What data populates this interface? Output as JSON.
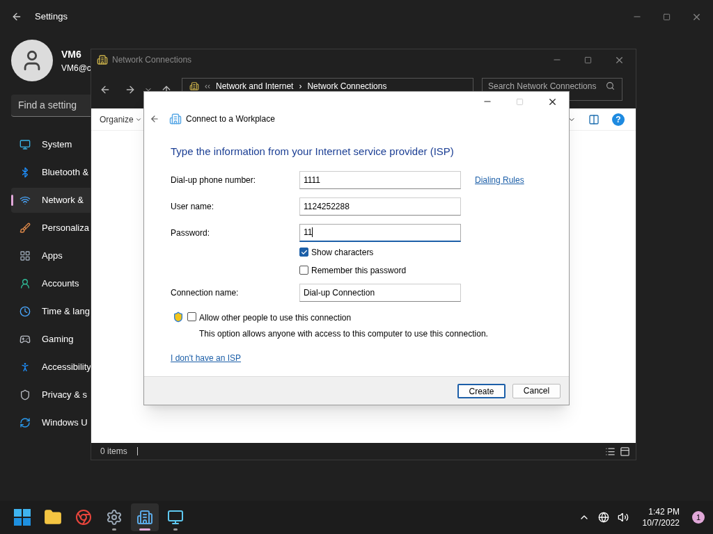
{
  "settings": {
    "title": "Settings",
    "user": {
      "name": "VM6",
      "email": "VM6@c"
    },
    "search": {
      "placeholder": "Find a setting"
    },
    "nav": [
      {
        "label": "System",
        "kind": "system",
        "selected": false
      },
      {
        "label": "Bluetooth &",
        "kind": "bluetooth",
        "selected": false
      },
      {
        "label": "Network &",
        "kind": "network",
        "selected": true
      },
      {
        "label": "Personaliza",
        "kind": "brush",
        "selected": false
      },
      {
        "label": "Apps",
        "kind": "apps",
        "selected": false
      },
      {
        "label": "Accounts",
        "kind": "accounts",
        "selected": false
      },
      {
        "label": "Time & lang",
        "kind": "time",
        "selected": false
      },
      {
        "label": "Gaming",
        "kind": "gaming",
        "selected": false
      },
      {
        "label": "Accessibility",
        "kind": "accessibility",
        "selected": false
      },
      {
        "label": "Privacy & s",
        "kind": "privacy",
        "selected": false
      },
      {
        "label": "Windows U",
        "kind": "update",
        "selected": false
      }
    ]
  },
  "explorer": {
    "title": "Network Connections",
    "overflow": "‹‹",
    "separator": "›",
    "help": "?",
    "breadcrumb": [
      "Network and Internet",
      "Network Connections"
    ],
    "search": {
      "placeholder": "Search Network Connections"
    },
    "organize": "Organize",
    "status": "0 items"
  },
  "dialog": {
    "title": "Connect to a Workplace",
    "heading": "Type the information from your Internet service provider (ISP)",
    "fields": [
      {
        "label": "Dial-up phone number:",
        "value": "1111",
        "focused": false
      },
      {
        "label": "User name:",
        "value": "1124252288",
        "focused": false
      },
      {
        "label": "Password:",
        "value": "11",
        "focused": true
      }
    ],
    "dialing_rules": "Dialing Rules",
    "checks": [
      {
        "label": "Show characters",
        "checked": true
      },
      {
        "label": "Remember this password",
        "checked": false
      }
    ],
    "connection": {
      "label": "Connection name:",
      "value": "Dial-up Connection"
    },
    "allow": {
      "label": "Allow other people to use this connection",
      "checked": false,
      "note": "This option allows anyone with access to this computer to use this connection."
    },
    "isp_link": "I don't have an ISP",
    "buttons": [
      {
        "label": "Create",
        "default": true
      },
      {
        "label": "Cancel",
        "default": false
      }
    ]
  },
  "taskbar": {
    "apps": [
      {
        "kind": "start",
        "running": false,
        "selected": false
      },
      {
        "kind": "folder",
        "running": false,
        "selected": false
      },
      {
        "kind": "browser",
        "running": false,
        "selected": false
      },
      {
        "kind": "settings",
        "running": true,
        "selected": false
      },
      {
        "kind": "network",
        "running": true,
        "selected": true
      },
      {
        "kind": "control",
        "running": true,
        "selected": false
      }
    ],
    "time": "1:42 PM",
    "date": "10/7/2022",
    "badge": "1"
  }
}
